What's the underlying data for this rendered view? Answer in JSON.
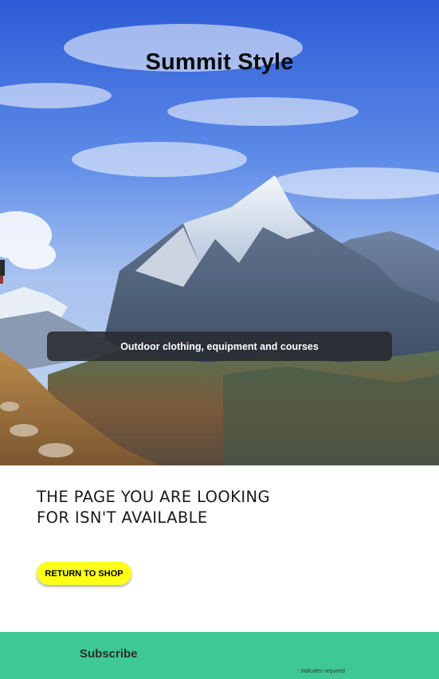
{
  "hero": {
    "brand_title": "Summit Style",
    "tagline": "Outdoor clothing, equipment and courses"
  },
  "main": {
    "heading_line1": "THE PAGE YOU ARE LOOKING",
    "heading_line2": "FOR ISN'T AVAILABLE",
    "return_button_label": "RETURN TO SHOP"
  },
  "subscribe": {
    "title": "Subscribe",
    "required_asterisk": "*",
    "required_note": "indicates required"
  },
  "colors": {
    "button_bg": "#ffff1a",
    "subscribe_bg": "#3ec994",
    "tagline_bg": "#282a30"
  }
}
